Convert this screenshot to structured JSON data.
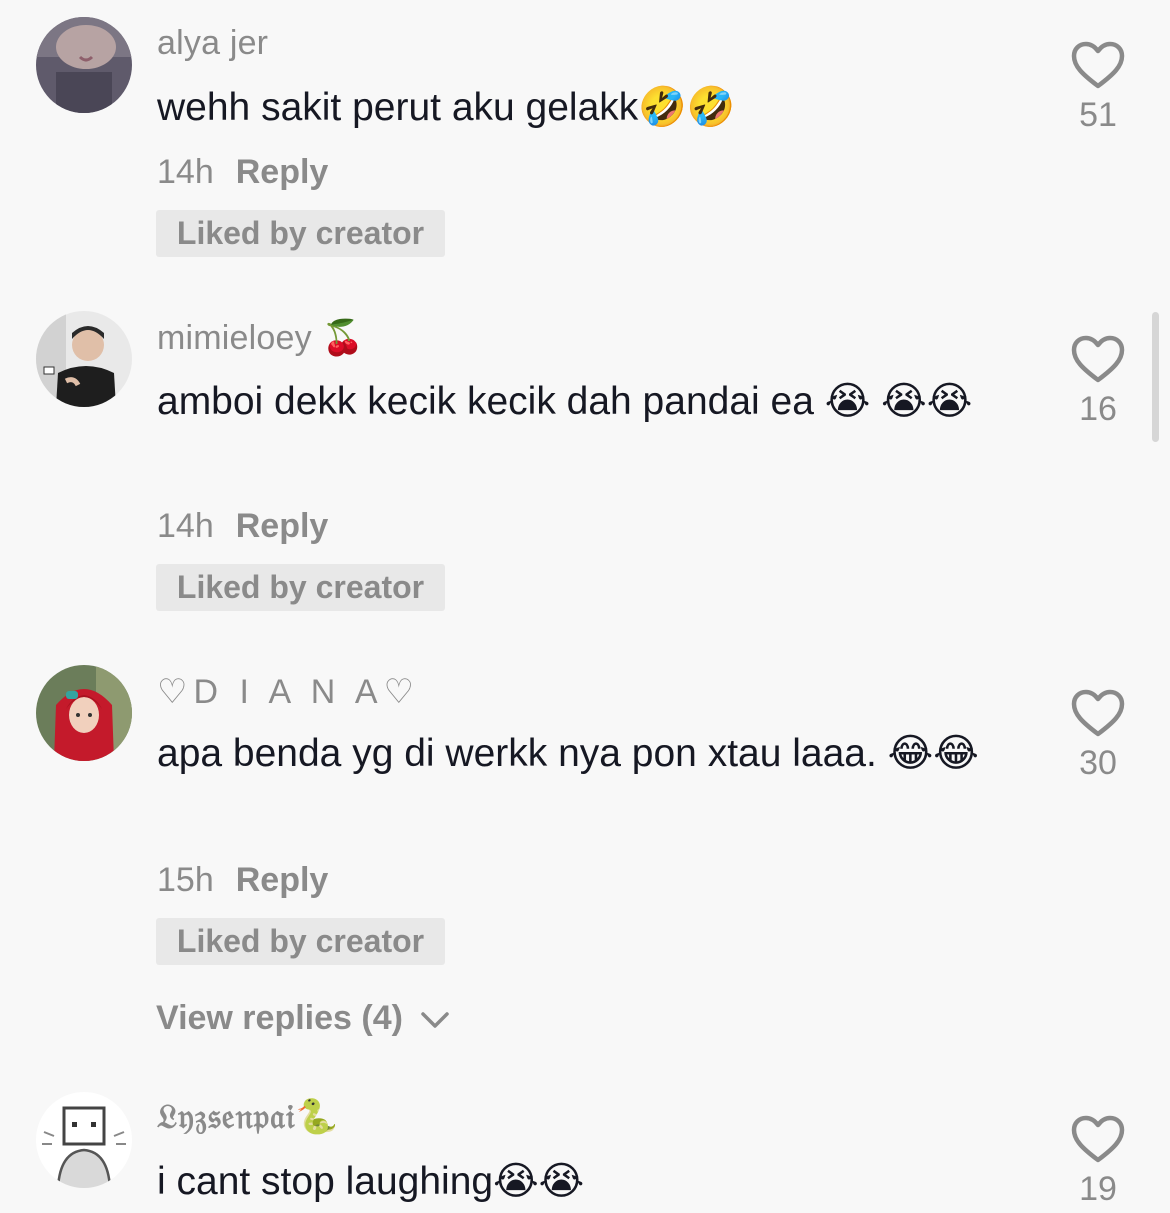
{
  "comments": [
    {
      "username": "alya jer",
      "text": "wehh sakit perut aku gelakk🤣🤣",
      "time": "14h",
      "reply_label": "Reply",
      "badge": "Liked by creator",
      "likes": "51"
    },
    {
      "username": "mimieloey 🍒",
      "text": "amboi dekk kecik kecik dah pandai ea 😭 😭😭",
      "time": "14h",
      "reply_label": "Reply",
      "badge": "Liked by creator",
      "likes": "16"
    },
    {
      "username": "♡D I A N A♡",
      "text": "apa benda yg di werkk nya pon xtau laaa. 😂😂",
      "time": "15h",
      "reply_label": "Reply",
      "badge": "Liked by creator",
      "likes": "30",
      "view_replies": "View replies (4)"
    },
    {
      "username": "𝔏𝔶𝔷𝔰𝔢𝔫𝔭𝔞𝔦🐍",
      "text": "i cant stop laughing😭😭",
      "likes": "19"
    }
  ],
  "icons": {
    "like": "heart-outline-icon",
    "expand": "chevron-down-icon"
  },
  "colors": {
    "background": "#f8f8f8",
    "secondary_text": "#8a8a8a",
    "primary_text": "#161823",
    "badge_bg": "#e8e8e8"
  }
}
